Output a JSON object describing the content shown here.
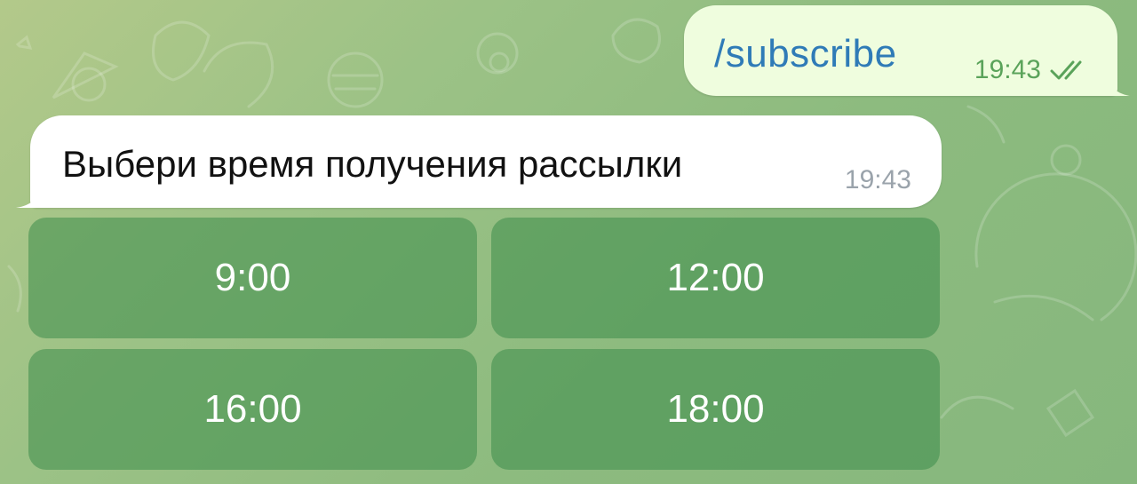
{
  "outgoing_message": {
    "text": "/subscribe",
    "time": "19:43",
    "status_icon": "double-check-icon"
  },
  "incoming_message": {
    "text": "Выбери время получения рассылки",
    "time": "19:43"
  },
  "inline_keyboard": {
    "buttons": [
      {
        "label": "9:00"
      },
      {
        "label": "12:00"
      },
      {
        "label": "16:00"
      },
      {
        "label": "18:00"
      }
    ]
  },
  "colors": {
    "outgoing_bubble": "#effdde",
    "incoming_bubble": "#ffffff",
    "command_text": "#2f7bb7",
    "read_check": "#5aa35a",
    "keyboard_button": "#4a9a5c"
  }
}
